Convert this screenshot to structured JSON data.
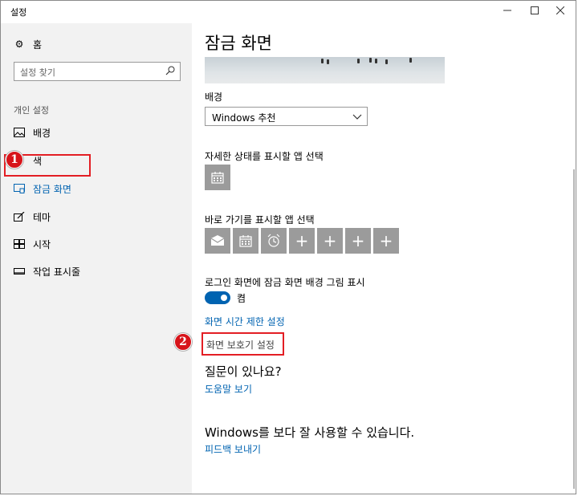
{
  "window": {
    "title": "설정"
  },
  "sidebar": {
    "home_label": "홈",
    "search_placeholder": "설정 찾기",
    "section_label": "개인 설정",
    "items": [
      {
        "label": "배경",
        "icon": "picture-icon"
      },
      {
        "label": "색",
        "icon": "palette-icon"
      },
      {
        "label": "잠금 화면",
        "icon": "lock-screen-icon",
        "active": true
      },
      {
        "label": "테마",
        "icon": "theme-brush-icon"
      },
      {
        "label": "시작",
        "icon": "start-grid-icon"
      },
      {
        "label": "작업 표시줄",
        "icon": "taskbar-icon"
      }
    ]
  },
  "annotations": {
    "badge_1": "1",
    "badge_2": "2"
  },
  "main": {
    "title": "잠금 화면",
    "background_label": "배경",
    "background_value": "Windows 추천",
    "detailed_status_label": "자세한 상태를 표시할 앱 선택",
    "quick_status_label": "바로 가기를 표시할 앱 선택",
    "signin_bg_label": "로그인 화면에 잠금 화면 배경 그림 표시",
    "toggle_state": "켬",
    "screen_timeout_link": "화면 시간 제한 설정",
    "screensaver_link": "화면 보호기 설정",
    "question_heading": "질문이 있나요?",
    "help_link": "도움말 보기",
    "better_heading": "Windows를 보다 잘 사용할 수 있습니다.",
    "feedback_link": "피드백 보내기"
  },
  "colors": {
    "accent": "#0063b1",
    "highlight": "#e31e24",
    "tile": "#9b9b9b"
  }
}
